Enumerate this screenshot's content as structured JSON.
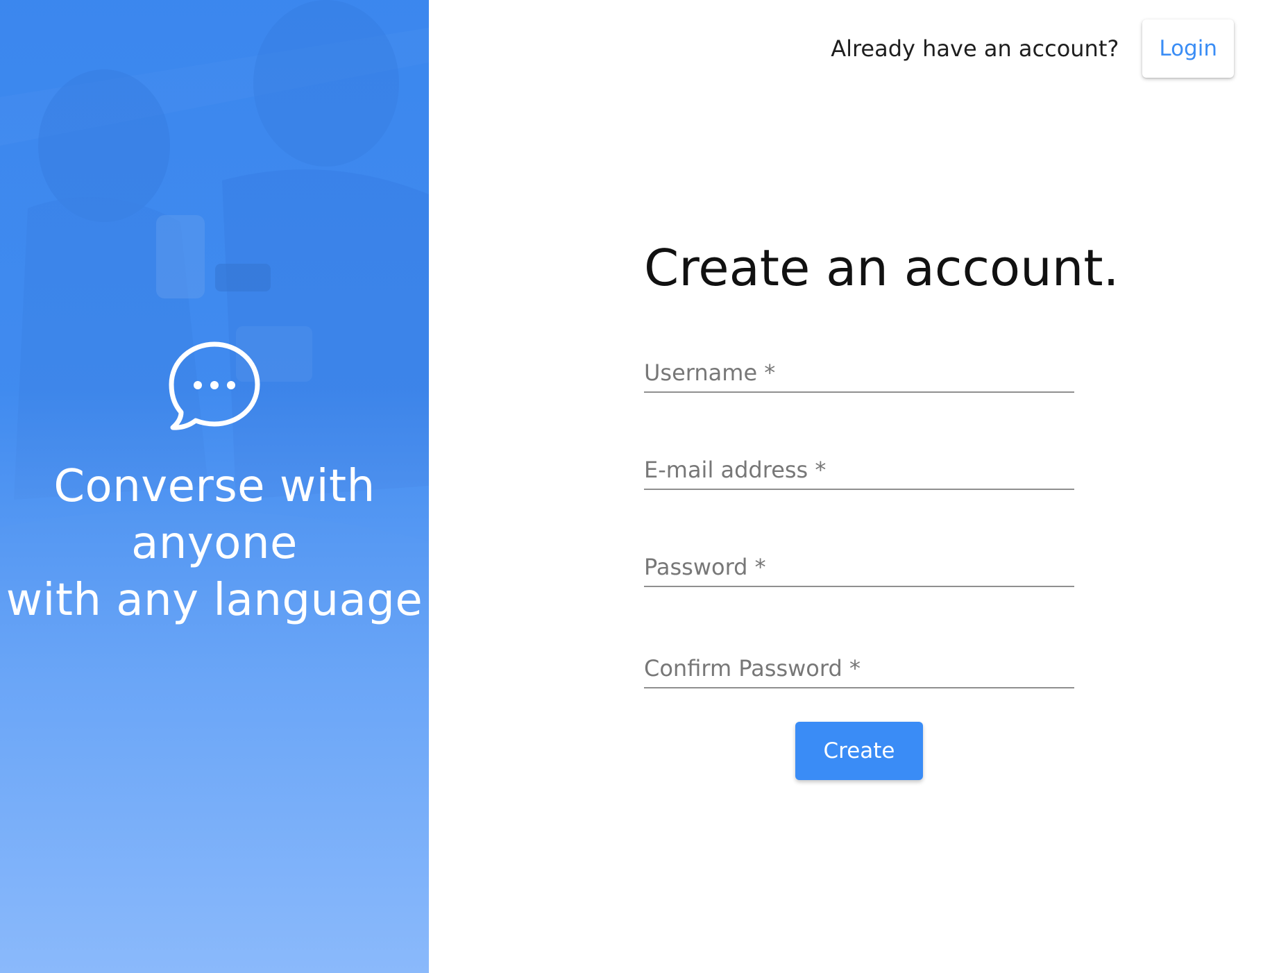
{
  "hero": {
    "icon": "chat-bubble-icon",
    "tagline_lines": [
      "Converse with",
      "anyone",
      "with any language"
    ]
  },
  "header": {
    "prompt": "Already have an account?",
    "login_label": "Login"
  },
  "form": {
    "title": "Create an account.",
    "fields": [
      {
        "name": "username",
        "placeholder": "Username *",
        "value": ""
      },
      {
        "name": "email",
        "placeholder": "E-mail address *",
        "value": ""
      },
      {
        "name": "password",
        "placeholder": "Password *",
        "value": ""
      },
      {
        "name": "confirm_password",
        "placeholder": "Confirm Password *",
        "value": ""
      }
    ],
    "submit_label": "Create"
  },
  "colors": {
    "accent": "#3a8cf6",
    "hero_top": "#3f8cf0",
    "hero_bottom": "#8ab9fb"
  }
}
